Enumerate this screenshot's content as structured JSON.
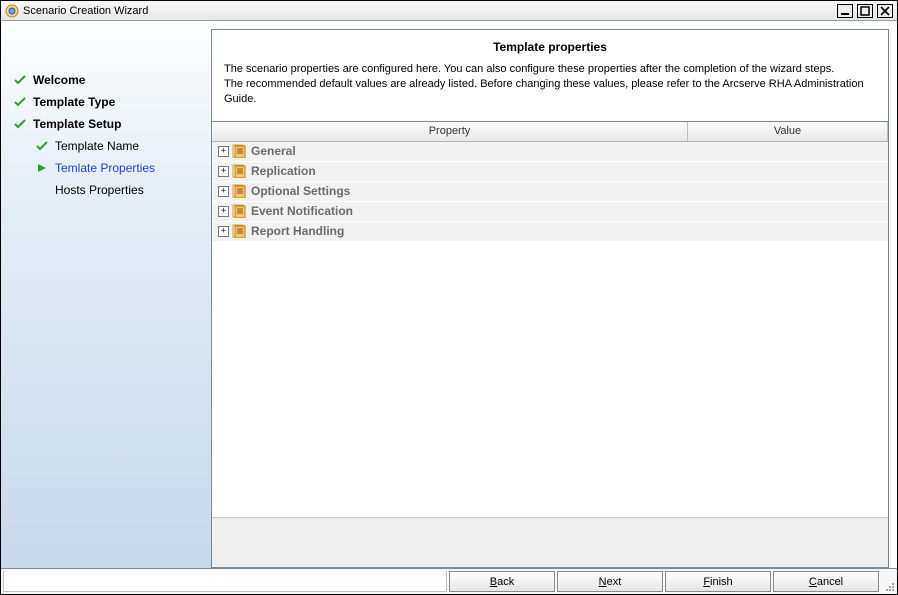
{
  "window": {
    "title": "Scenario Creation Wizard"
  },
  "sidebar": {
    "steps": [
      {
        "label": "Welcome"
      },
      {
        "label": "Template Type"
      },
      {
        "label": "Template Setup"
      }
    ],
    "substeps": [
      {
        "label": "Template Name"
      },
      {
        "label": "Temlate Properties"
      },
      {
        "label": "Hosts Properties"
      }
    ]
  },
  "main": {
    "panel_title": "Template properties",
    "description_line1": "The scenario properties are configured here. You can also configure these properties after the completion of the wizard steps.",
    "description_line2": "The recommended default values are already listed. Before changing these values, please refer to the Arcserve RHA Administration Guide.",
    "columns": {
      "property": "Property",
      "value": "Value"
    },
    "rows": [
      {
        "label": "General"
      },
      {
        "label": "Replication"
      },
      {
        "label": "Optional Settings"
      },
      {
        "label": "Event Notification"
      },
      {
        "label": "Report Handling"
      }
    ]
  },
  "buttons": {
    "back": {
      "u": "B",
      "rest": "ack"
    },
    "next": {
      "u": "N",
      "rest": "ext"
    },
    "finish": {
      "u": "F",
      "rest": "inish"
    },
    "cancel": {
      "u": "C",
      "rest": "ancel"
    }
  }
}
